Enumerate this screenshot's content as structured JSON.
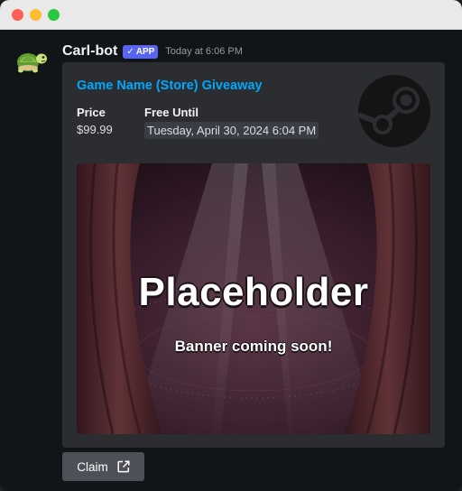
{
  "message": {
    "username": "Carl-bot",
    "badge": {
      "label": "APP",
      "check": "✓"
    },
    "timestamp": "Today at 6:06 PM",
    "avatar_icon": "turtle-icon"
  },
  "embed": {
    "title": "Game Name (Store) Giveaway",
    "fields": [
      {
        "name": "Price",
        "value": "$99.99"
      },
      {
        "name": "Free Until",
        "value": "Tuesday, April 30, 2024 6:04 PM"
      }
    ],
    "thumbnail_icon": "steam-icon",
    "banner": {
      "title": "Placeholder",
      "subtitle": "Banner coming soon!"
    }
  },
  "button": {
    "label": "Claim",
    "icon": "external-link-icon"
  },
  "colors": {
    "link": "#00a8fc",
    "badge": "#5865f2",
    "button": "#4e5058",
    "embed_bg": "#2b2d31"
  }
}
